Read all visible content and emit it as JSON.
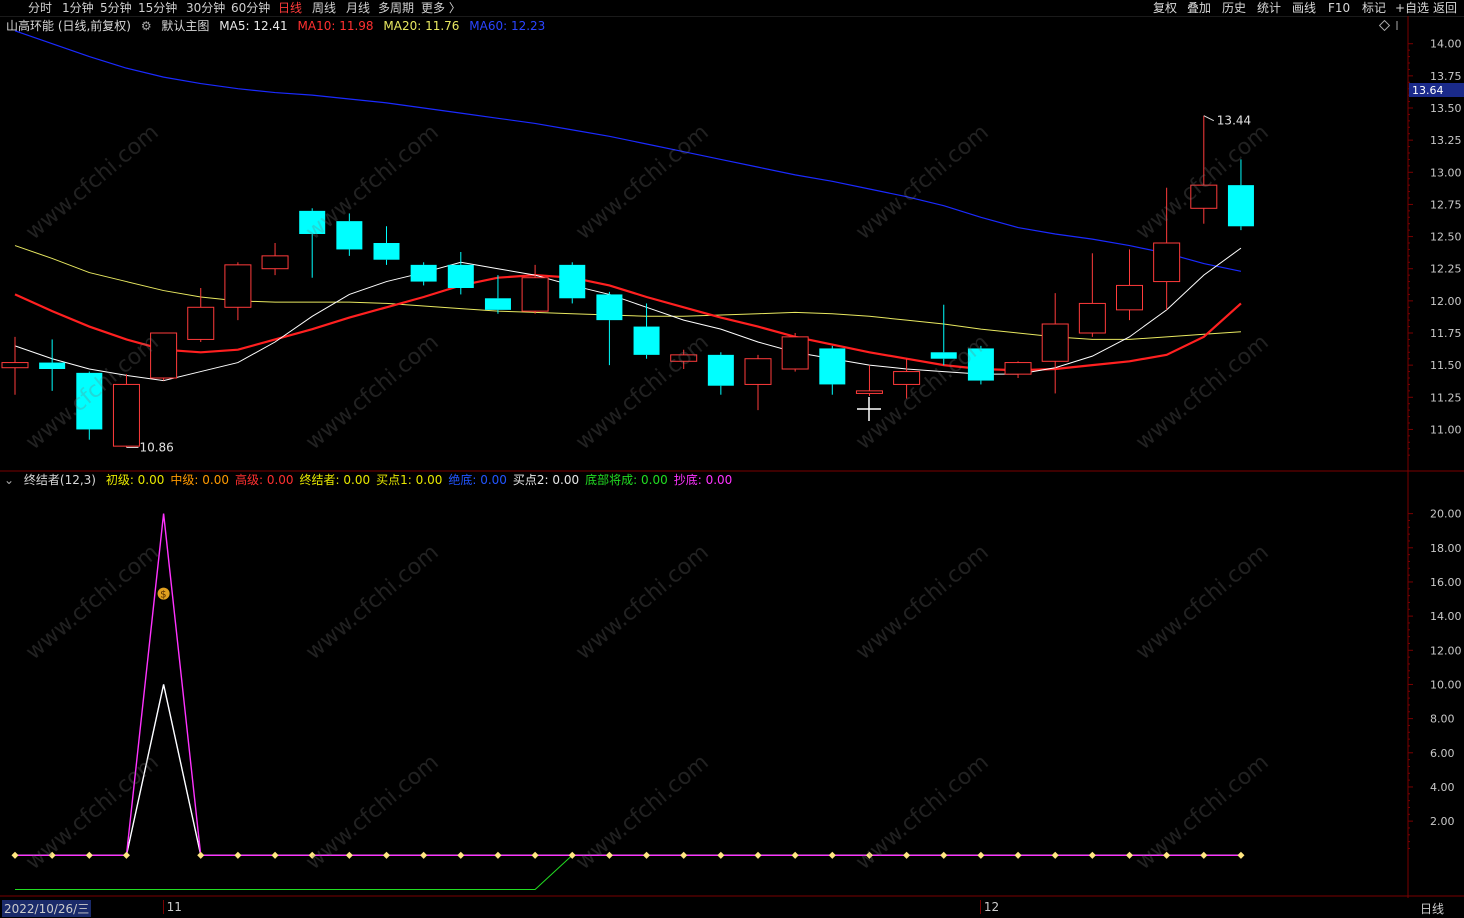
{
  "toolbar": {
    "periods": [
      "分时",
      "1分钟",
      "5分钟",
      "15分钟",
      "30分钟",
      "60分钟",
      "日线",
      "周线",
      "月线",
      "多周期",
      "更多 〉"
    ],
    "active_period": "日线",
    "right_buttons": [
      "复权",
      "叠加",
      "历史",
      "统计",
      "画线",
      "F10",
      "标记",
      "+自选",
      "返回"
    ]
  },
  "main_legend": {
    "stock": "山高环能 (日线,前复权)",
    "template": "默认主图",
    "ma5": "MA5: 12.41",
    "ma10": "MA10: 11.98",
    "ma20": "MA20: 11.76",
    "ma60": "MA60: 12.23"
  },
  "indicator_legend": {
    "name": "终结者(12,3)",
    "items": [
      {
        "label": "初级: 0.00",
        "color": "#e8e800"
      },
      {
        "label": "中级: 0.00",
        "color": "#ff9900"
      },
      {
        "label": "高级: 0.00",
        "color": "#ff3030"
      },
      {
        "label": "终结者: 0.00",
        "color": "#e8e800"
      },
      {
        "label": "买点1: 0.00",
        "color": "#e8e800"
      },
      {
        "label": "绝底: 0.00",
        "color": "#2255ff"
      },
      {
        "label": "买点2: 0.00",
        "color": "#e8e8e8"
      },
      {
        "label": "底部将成: 0.00",
        "color": "#22dd22"
      },
      {
        "label": "抄底: 0.00",
        "color": "#ff33ff"
      }
    ]
  },
  "price_axis": {
    "ticks": [
      "14.00",
      "13.75",
      "13.50",
      "13.25",
      "13.00",
      "12.75",
      "12.50",
      "12.25",
      "12.00",
      "11.75",
      "11.50",
      "11.25",
      "11.00"
    ],
    "current_price": "13.64"
  },
  "indicator_axis": {
    "ticks": [
      "20.00",
      "18.00",
      "16.00",
      "14.00",
      "12.00",
      "10.00",
      "8.00",
      "6.00",
      "4.00",
      "2.00"
    ]
  },
  "annotations": {
    "high": "13.44",
    "low": "10.86"
  },
  "date_axis": {
    "start": "2022/10/26/三",
    "labels": [
      "11",
      "12"
    ],
    "period": "日线"
  },
  "watermark": "www.cfchi.com",
  "colors": {
    "up": "#ff3b3b",
    "down": "#00ffff",
    "ma5": "#ffffff",
    "ma10": "#ff2020",
    "ma20": "#e8e860",
    "ma60": "#1a2aff",
    "grid": "#7a0000"
  },
  "chart_data": {
    "type": "candlestick",
    "ylim": [
      10.7,
      14.2
    ],
    "candles": [
      {
        "o": 11.48,
        "c": 11.52,
        "h": 11.72,
        "l": 11.27
      },
      {
        "o": 11.52,
        "c": 11.47,
        "h": 11.7,
        "l": 11.3
      },
      {
        "o": 11.44,
        "c": 11.0,
        "h": 11.45,
        "l": 10.92
      },
      {
        "o": 10.87,
        "c": 11.35,
        "h": 11.43,
        "l": 10.86
      },
      {
        "o": 11.4,
        "c": 11.75,
        "h": 11.75,
        "l": 11.38
      },
      {
        "o": 11.7,
        "c": 11.95,
        "h": 12.1,
        "l": 11.68
      },
      {
        "o": 11.95,
        "c": 12.28,
        "h": 12.3,
        "l": 11.85
      },
      {
        "o": 12.25,
        "c": 12.35,
        "h": 12.45,
        "l": 12.2
      },
      {
        "o": 12.7,
        "c": 12.52,
        "h": 12.72,
        "l": 12.18
      },
      {
        "o": 12.62,
        "c": 12.4,
        "h": 12.68,
        "l": 12.35
      },
      {
        "o": 12.45,
        "c": 12.32,
        "h": 12.58,
        "l": 12.28
      },
      {
        "o": 12.28,
        "c": 12.15,
        "h": 12.3,
        "l": 12.12
      },
      {
        "o": 12.28,
        "c": 12.1,
        "h": 12.38,
        "l": 12.05
      },
      {
        "o": 12.02,
        "c": 11.93,
        "h": 12.2,
        "l": 11.9
      },
      {
        "o": 11.92,
        "c": 12.18,
        "h": 12.28,
        "l": 11.9
      },
      {
        "o": 12.28,
        "c": 12.02,
        "h": 12.3,
        "l": 11.98
      },
      {
        "o": 12.05,
        "c": 11.85,
        "h": 12.07,
        "l": 11.5
      },
      {
        "o": 11.8,
        "c": 11.58,
        "h": 11.98,
        "l": 11.55
      },
      {
        "o": 11.53,
        "c": 11.58,
        "h": 11.62,
        "l": 11.47
      },
      {
        "o": 11.58,
        "c": 11.34,
        "h": 11.6,
        "l": 11.27
      },
      {
        "o": 11.35,
        "c": 11.55,
        "h": 11.58,
        "l": 11.15
      },
      {
        "o": 11.47,
        "c": 11.72,
        "h": 11.75,
        "l": 11.45
      },
      {
        "o": 11.63,
        "c": 11.35,
        "h": 11.65,
        "l": 11.27
      },
      {
        "o": 11.28,
        "c": 11.3,
        "h": 11.5,
        "l": 11.26
      },
      {
        "o": 11.35,
        "c": 11.45,
        "h": 11.55,
        "l": 11.24
      },
      {
        "o": 11.6,
        "c": 11.55,
        "h": 11.97,
        "l": 11.5
      },
      {
        "o": 11.63,
        "c": 11.38,
        "h": 11.65,
        "l": 11.35
      },
      {
        "o": 11.43,
        "c": 11.52,
        "h": 11.53,
        "l": 11.4
      },
      {
        "o": 11.53,
        "c": 11.82,
        "h": 12.06,
        "l": 11.28
      },
      {
        "o": 11.75,
        "c": 11.98,
        "h": 12.37,
        "l": 11.72
      },
      {
        "o": 11.93,
        "c": 12.12,
        "h": 12.4,
        "l": 11.85
      },
      {
        "o": 12.15,
        "c": 12.45,
        "h": 12.88,
        "l": 11.93
      },
      {
        "o": 12.72,
        "c": 12.9,
        "h": 13.44,
        "l": 12.6
      },
      {
        "o": 12.9,
        "c": 12.58,
        "h": 13.1,
        "l": 12.55
      }
    ],
    "ma5": [
      11.65,
      11.55,
      11.47,
      11.42,
      11.38,
      11.45,
      11.52,
      11.68,
      11.88,
      12.05,
      12.15,
      12.22,
      12.3,
      12.25,
      12.2,
      12.12,
      12.05,
      11.95,
      11.85,
      11.78,
      11.68,
      11.6,
      11.55,
      11.5,
      11.47,
      11.45,
      11.43,
      11.43,
      11.48,
      11.57,
      11.72,
      11.93,
      12.2,
      12.41
    ],
    "ma10": [
      12.05,
      11.92,
      11.8,
      11.7,
      11.62,
      11.6,
      11.62,
      11.7,
      11.78,
      11.87,
      11.95,
      12.03,
      12.12,
      12.18,
      12.2,
      12.18,
      12.12,
      12.03,
      11.95,
      11.87,
      11.8,
      11.72,
      11.66,
      11.6,
      11.55,
      11.5,
      11.47,
      11.46,
      11.47,
      11.5,
      11.53,
      11.58,
      11.72,
      11.98
    ],
    "ma20": [
      12.43,
      12.33,
      12.22,
      12.15,
      12.08,
      12.03,
      12.0,
      11.99,
      11.99,
      11.99,
      11.98,
      11.96,
      11.94,
      11.92,
      11.91,
      11.9,
      11.89,
      11.88,
      11.88,
      11.89,
      11.9,
      11.91,
      11.9,
      11.88,
      11.85,
      11.82,
      11.78,
      11.75,
      11.72,
      11.7,
      11.7,
      11.72,
      11.74,
      11.76
    ],
    "ma60": [
      14.1,
      14.0,
      13.9,
      13.81,
      13.74,
      13.69,
      13.65,
      13.62,
      13.6,
      13.57,
      13.54,
      13.5,
      13.46,
      13.42,
      13.38,
      13.33,
      13.28,
      13.22,
      13.16,
      13.1,
      13.04,
      12.98,
      12.93,
      12.87,
      12.81,
      12.74,
      12.65,
      12.57,
      12.52,
      12.48,
      12.43,
      12.37,
      12.29,
      12.23
    ],
    "indicator": {
      "ylim": [
        -2.5,
        21.5
      ],
      "chaodi": [
        0,
        0,
        0,
        0,
        20,
        0,
        0,
        0,
        0,
        0,
        0,
        0,
        0,
        0,
        0,
        0,
        0,
        0,
        0,
        0,
        0,
        0,
        0,
        0,
        0,
        0,
        0,
        0,
        0,
        0,
        0,
        0,
        0,
        0
      ],
      "maidian2": [
        0,
        0,
        0,
        0,
        10,
        0,
        0,
        0,
        0,
        0,
        0,
        0,
        0,
        0,
        0,
        0,
        0,
        0,
        0,
        0,
        0,
        0,
        0,
        0,
        0,
        0,
        0,
        0,
        0,
        0,
        0,
        0,
        0,
        0
      ],
      "dibu": [
        -2,
        -2,
        -2,
        -2,
        -2,
        -2,
        -2,
        -2,
        -2,
        -2,
        -2,
        -2,
        -2,
        -2,
        -2,
        0,
        0,
        0,
        0,
        0,
        0,
        0,
        0,
        0,
        0,
        0,
        0,
        0,
        0,
        0,
        0,
        0,
        0,
        0
      ]
    }
  }
}
